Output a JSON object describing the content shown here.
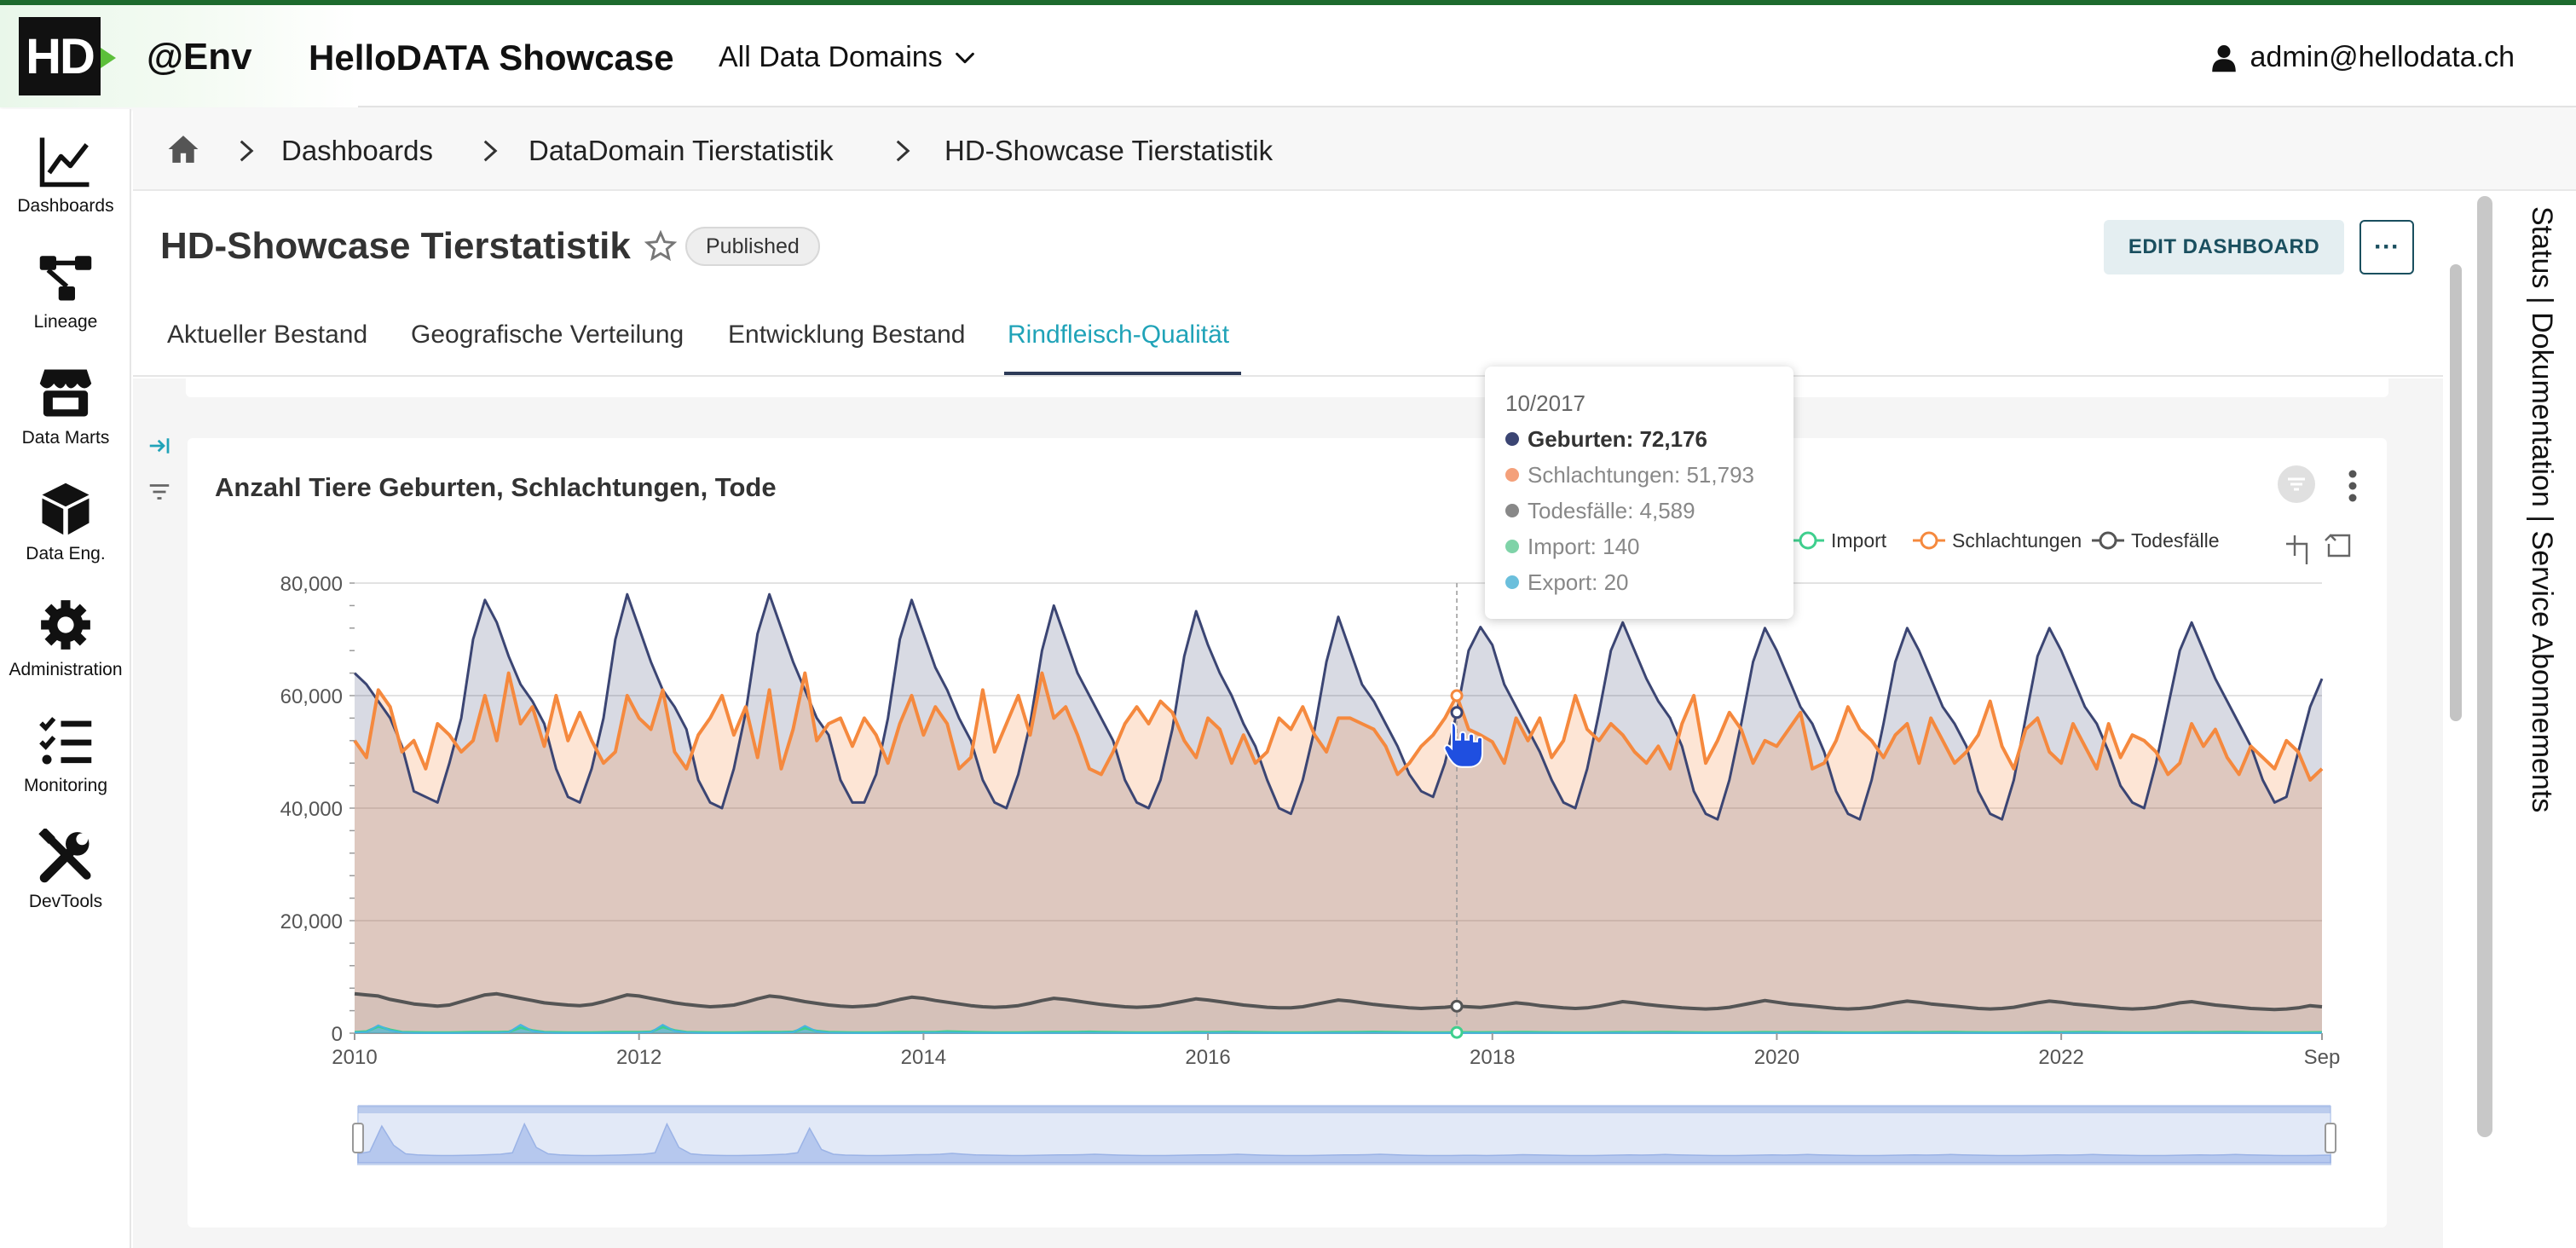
{
  "header": {
    "logo_text": "HD",
    "env": "@Env",
    "app_title": "HelloDATA Showcase",
    "domains_label": "All Data Domains",
    "user_email": "admin@hellodata.ch"
  },
  "sidebar": {
    "items": [
      {
        "label": "Dashboards",
        "icon": "chart-line-icon"
      },
      {
        "label": "Lineage",
        "icon": "lineage-icon"
      },
      {
        "label": "Data Marts",
        "icon": "store-icon"
      },
      {
        "label": "Data Eng.",
        "icon": "cube-icon"
      },
      {
        "label": "Administration",
        "icon": "gear-icon"
      },
      {
        "label": "Monitoring",
        "icon": "list-check-icon"
      },
      {
        "label": "DevTools",
        "icon": "tools-icon"
      }
    ]
  },
  "breadcrumb": {
    "items": [
      "Dashboards",
      "DataDomain Tierstatistik",
      "HD-Showcase Tierstatistik"
    ]
  },
  "dashboard": {
    "title": "HD-Showcase Tierstatistik",
    "status": "Published",
    "edit_label": "EDIT DASHBOARD",
    "more_label": "···"
  },
  "tabs": [
    "Aktueller Bestand",
    "Geografische Verteilung",
    "Entwicklung Bestand",
    "Rindfleisch-Qualität"
  ],
  "active_tab": "Rindfleisch-Qualität",
  "right_rail": {
    "text": "Status | Dokumentation | Service Abonnements"
  },
  "tooltip": {
    "date": "10/2017",
    "rows": [
      {
        "label": "Geburten: 72,176",
        "color": "#3b4573"
      },
      {
        "label": "Schlachtungen: 51,793",
        "color": "#f4a07a"
      },
      {
        "label": "Todesfälle: 4,589",
        "color": "#888888"
      },
      {
        "label": "Import: 140",
        "color": "#7fd3a8"
      },
      {
        "label": "Export: 20",
        "color": "#6bbfdc"
      }
    ]
  },
  "colors": {
    "geburten": "#3b4573",
    "schlachtungen": "#f5893e",
    "todesfaelle": "#555555",
    "import": "#3fcf8e",
    "export": "#46b4e0",
    "active_tab": "#20a3b8"
  },
  "chart_data": {
    "type": "area",
    "title": "Anzahl Tiere Geburten, Schlachtungen, Tode",
    "x_start": "2010-01",
    "x_end": "2023-09",
    "x_ticks": [
      "2010",
      "2012",
      "2014",
      "2016",
      "2018",
      "2020",
      "2022",
      "Sep"
    ],
    "y_ticks": [
      "0",
      "20,000",
      "40,000",
      "60,000",
      "80,000"
    ],
    "ylim": [
      0,
      80000
    ],
    "legend": [
      "Import",
      "Schlachtungen",
      "Todesfälle"
    ],
    "legend_position": "top-right",
    "series": [
      {
        "name": "Geburten",
        "values": [
          64000,
          62000,
          59000,
          56000,
          51000,
          43000,
          42000,
          41000,
          48000,
          56000,
          70000,
          77000,
          73000,
          67000,
          62000,
          59000,
          55000,
          47000,
          42000,
          41000,
          47000,
          56000,
          70000,
          78000,
          72000,
          66000,
          61000,
          58000,
          54000,
          45000,
          41000,
          40000,
          47000,
          57000,
          71000,
          78000,
          72000,
          66000,
          61000,
          56000,
          53000,
          45000,
          41000,
          41000,
          46000,
          56000,
          70000,
          77000,
          71000,
          65000,
          61000,
          56000,
          52000,
          45000,
          41000,
          40000,
          46000,
          55000,
          68000,
          76000,
          70000,
          64000,
          60000,
          56000,
          52000,
          45000,
          41000,
          40000,
          45000,
          54000,
          67000,
          75000,
          69000,
          64000,
          60000,
          55000,
          51000,
          45000,
          40000,
          39000,
          45000,
          54000,
          66000,
          74000,
          68000,
          62000,
          59000,
          55000,
          51000,
          46000,
          43000,
          42000,
          48000,
          57000,
          68000,
          72176,
          69000,
          62000,
          58000,
          54000,
          50000,
          45000,
          41000,
          40000,
          47000,
          57000,
          68000,
          73000,
          68000,
          63000,
          59000,
          56000,
          51000,
          43000,
          39000,
          38000,
          45000,
          55000,
          66000,
          72000,
          68000,
          63000,
          58000,
          55000,
          50000,
          43000,
          39000,
          38000,
          45000,
          55000,
          66000,
          72000,
          68000,
          63000,
          58000,
          55000,
          51000,
          43000,
          39000,
          38000,
          45000,
          56000,
          67000,
          72000,
          68000,
          63000,
          58000,
          55000,
          50000,
          44000,
          41000,
          40000,
          48000,
          58000,
          68000,
          73000,
          68000,
          63000,
          59000,
          55000,
          51000,
          45000,
          41000,
          42000,
          50000,
          58000,
          63000
        ]
      },
      {
        "name": "Schlachtungen",
        "values": [
          52000,
          49000,
          61000,
          58000,
          50000,
          52000,
          47000,
          55000,
          53000,
          50000,
          52000,
          60000,
          52000,
          64000,
          55000,
          58000,
          51000,
          60000,
          52000,
          57000,
          52000,
          48000,
          50000,
          60000,
          56000,
          54000,
          61000,
          50000,
          47000,
          53000,
          56000,
          60000,
          53000,
          58000,
          49000,
          61000,
          47000,
          54000,
          64000,
          52000,
          55000,
          56000,
          51000,
          56000,
          53000,
          48000,
          55000,
          60000,
          53000,
          58000,
          55000,
          47000,
          49000,
          61000,
          50000,
          55000,
          60000,
          53000,
          64000,
          56000,
          58000,
          53000,
          47000,
          46000,
          50000,
          55000,
          58000,
          55000,
          59000,
          57000,
          52000,
          49000,
          56000,
          54000,
          48000,
          53000,
          48000,
          50000,
          56000,
          54000,
          58000,
          53000,
          50000,
          56000,
          56000,
          55000,
          54000,
          51000,
          46000,
          48000,
          51000,
          53000,
          56000,
          60000,
          54000,
          53000,
          51793,
          48000,
          56000,
          52000,
          56000,
          49000,
          52000,
          60000,
          54000,
          52000,
          55000,
          53000,
          50000,
          48000,
          51000,
          47000,
          55000,
          60000,
          48000,
          52000,
          57000,
          54000,
          48000,
          52000,
          51000,
          54000,
          57000,
          47000,
          48000,
          52000,
          58000,
          54000,
          52000,
          49000,
          53000,
          55000,
          48000,
          56000,
          52000,
          48000,
          50000,
          53000,
          59000,
          51000,
          47000,
          54000,
          56000,
          50000,
          48000,
          55000,
          51000,
          47000,
          55000,
          49000,
          53000,
          52000,
          50000,
          46000,
          48000,
          55000,
          51000,
          54000,
          49000,
          46000,
          51000,
          49000,
          47000,
          52000,
          50000,
          45000,
          47000
        ]
      },
      {
        "name": "Todesfälle",
        "values": [
          7000,
          6800,
          6600,
          6000,
          5600,
          5200,
          5000,
          4800,
          5000,
          5600,
          6200,
          6800,
          7000,
          6600,
          6200,
          5800,
          5400,
          5200,
          5000,
          4900,
          5100,
          5600,
          6200,
          6800,
          6600,
          6200,
          5800,
          5400,
          5100,
          4900,
          4700,
          4800,
          5000,
          5500,
          6100,
          6600,
          6400,
          6000,
          5600,
          5300,
          5000,
          4800,
          4700,
          4800,
          5000,
          5500,
          6000,
          6400,
          6200,
          5800,
          5500,
          5200,
          4900,
          4700,
          4600,
          4700,
          4900,
          5300,
          5800,
          6200,
          6000,
          5700,
          5400,
          5100,
          4900,
          4700,
          4600,
          4700,
          4900,
          5300,
          5700,
          6100,
          5900,
          5600,
          5300,
          5000,
          4800,
          4600,
          4500,
          4500,
          4700,
          5100,
          5500,
          5900,
          5700,
          5400,
          5100,
          4900,
          4700,
          4500,
          4400,
          4500,
          4600,
          4800,
          4700,
          4589,
          4800,
          5100,
          5400,
          5200,
          4900,
          4700,
          4500,
          4400,
          4500,
          4800,
          5200,
          5600,
          5400,
          5100,
          4900,
          4700,
          4500,
          4400,
          4300,
          4400,
          4600,
          5000,
          5400,
          5800,
          5500,
          5200,
          5000,
          4800,
          4600,
          4400,
          4300,
          4400,
          4600,
          5000,
          5400,
          5700,
          5500,
          5200,
          5000,
          4800,
          4600,
          4400,
          4300,
          4400,
          4600,
          5000,
          5400,
          5700,
          5500,
          5200,
          5000,
          4800,
          4600,
          4400,
          4300,
          4400,
          4600,
          5000,
          5400,
          5600,
          5300,
          5000,
          4800,
          4600,
          4400,
          4300,
          4200,
          4300,
          4500,
          4900,
          4700
        ]
      },
      {
        "name": "Import",
        "values": [
          200,
          300,
          1200,
          600,
          200,
          150,
          120,
          100,
          120,
          150,
          180,
          200,
          200,
          250,
          1000,
          500,
          200,
          150,
          120,
          100,
          120,
          150,
          180,
          200,
          200,
          250,
          1100,
          500,
          200,
          150,
          120,
          100,
          120,
          150,
          180,
          200,
          200,
          250,
          900,
          400,
          200,
          150,
          120,
          100,
          120,
          150,
          180,
          200,
          180,
          200,
          300,
          250,
          180,
          150,
          120,
          100,
          120,
          150,
          160,
          180,
          180,
          200,
          250,
          200,
          160,
          140,
          120,
          100,
          120,
          140,
          160,
          180,
          160,
          180,
          220,
          200,
          160,
          140,
          120,
          100,
          120,
          140,
          150,
          170,
          160,
          180,
          220,
          200,
          160,
          140,
          120,
          100,
          120,
          140,
          150,
          140,
          150,
          170,
          200,
          180,
          150,
          130,
          110,
          100,
          110,
          130,
          150,
          160,
          150,
          170,
          200,
          180,
          150,
          130,
          110,
          100,
          110,
          130,
          150,
          160,
          150,
          170,
          200,
          180,
          150,
          130,
          110,
          100,
          110,
          130,
          150,
          160,
          150,
          170,
          200,
          180,
          150,
          130,
          110,
          100,
          110,
          130,
          150,
          160,
          150,
          170,
          200,
          180,
          150,
          130,
          110,
          100,
          110,
          130,
          150,
          160,
          150,
          170,
          200,
          180,
          150,
          130,
          110,
          100,
          110,
          130,
          150
        ]
      },
      {
        "name": "Export",
        "values": [
          100,
          200,
          1400,
          500,
          100,
          50,
          30,
          20,
          20,
          30,
          40,
          60,
          80,
          150,
          1500,
          400,
          100,
          50,
          30,
          20,
          20,
          30,
          40,
          60,
          80,
          150,
          1500,
          400,
          100,
          50,
          30,
          20,
          20,
          30,
          40,
          60,
          80,
          150,
          1300,
          300,
          80,
          40,
          30,
          20,
          20,
          30,
          40,
          60,
          60,
          80,
          120,
          80,
          50,
          40,
          30,
          20,
          20,
          30,
          40,
          50,
          50,
          60,
          80,
          60,
          40,
          30,
          20,
          20,
          20,
          30,
          40,
          50,
          50,
          60,
          80,
          60,
          40,
          30,
          20,
          20,
          20,
          30,
          40,
          50,
          50,
          60,
          80,
          60,
          40,
          30,
          20,
          20,
          20,
          30,
          30,
          20,
          30,
          40,
          60,
          50,
          40,
          30,
          20,
          20,
          20,
          30,
          40,
          50,
          40,
          50,
          70,
          50,
          40,
          30,
          20,
          20,
          20,
          30,
          40,
          50,
          40,
          50,
          70,
          50,
          40,
          30,
          20,
          20,
          20,
          30,
          40,
          50,
          40,
          50,
          70,
          50,
          40,
          30,
          20,
          20,
          20,
          30,
          40,
          50,
          40,
          50,
          70,
          50,
          40,
          30,
          20,
          20,
          20,
          30,
          40,
          50,
          40,
          50,
          70,
          50,
          40,
          30,
          20,
          20,
          20,
          30,
          40
        ]
      }
    ],
    "highlight": {
      "date": "10/2017"
    }
  }
}
